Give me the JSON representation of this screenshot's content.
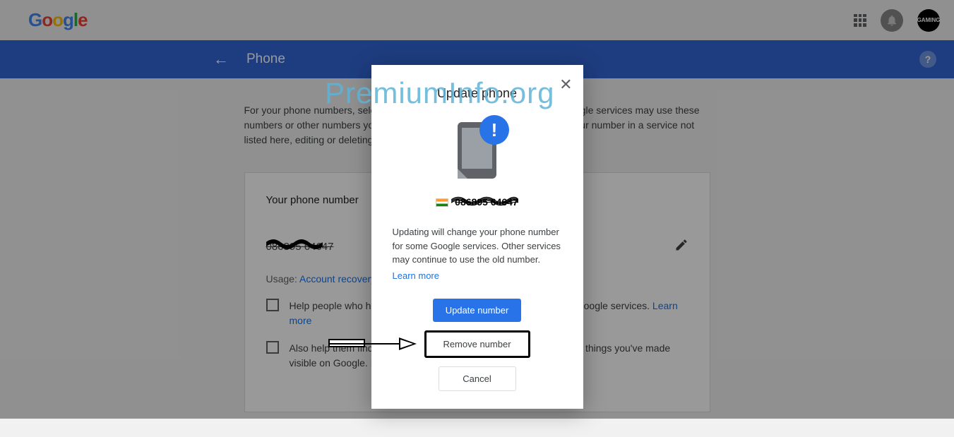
{
  "header": {
    "avatar_text": "GAMING"
  },
  "subheader": {
    "title": "Phone"
  },
  "main": {
    "description": "For your phone numbers, select which Google services use them. Other Google services may use these numbers or other numbers you've saved, for example, so you can recover your number in a service not listed here, editing or deleting your number here won't affect it in that service.",
    "card_title": "Your phone number",
    "phone_masked": "086895 64647",
    "usage_label": "Usage:",
    "usage_link": "Account recovery",
    "check1": "Help people who have your number find and connect with you on Google services.",
    "check1_link": "Learn more",
    "check2": "Also help them find and connect with you on Google services using things you've made visible on Google.",
    "check2_link": "Learn more"
  },
  "modal": {
    "title": "Update phone",
    "phone_masked": "086895 64647",
    "description": "Updating will change your phone number for some Google services. Other services may continue to use the old number.",
    "learn_more": "Learn more",
    "btn_update": "Update number",
    "btn_remove": "Remove number",
    "btn_cancel": "Cancel"
  },
  "watermark": "PremiumInfo.org"
}
